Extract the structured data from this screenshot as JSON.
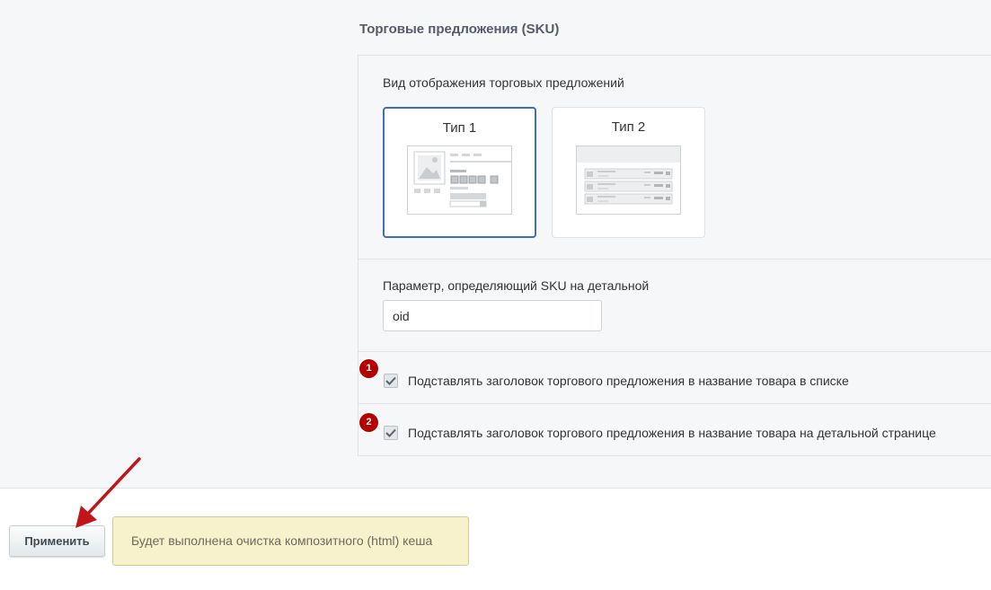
{
  "section": {
    "title": "Торговые предложения (SKU)"
  },
  "view": {
    "label": "Вид отображения торговых предложений",
    "options": [
      {
        "label": "Тип 1",
        "selected": true
      },
      {
        "label": "Тип 2",
        "selected": false
      }
    ]
  },
  "param": {
    "label": "Параметр, определяющий SKU на детальной",
    "value": "oid"
  },
  "checkboxes": [
    {
      "badge": "1",
      "label": "Подставлять заголовок торгового предложения в название товара в списке",
      "checked": true
    },
    {
      "badge": "2",
      "label": "Подставлять заголовок торгового предложения в название товара на детальной странице",
      "checked": true
    }
  ],
  "footer": {
    "apply_label": "Применить",
    "notice": "Будет выполнена очистка композитного (html) кеша"
  },
  "colors": {
    "accent": "#3e6dbd",
    "badge": "#b50000",
    "notice_bg": "#f7f1cc",
    "arrow": "#c0161b"
  }
}
